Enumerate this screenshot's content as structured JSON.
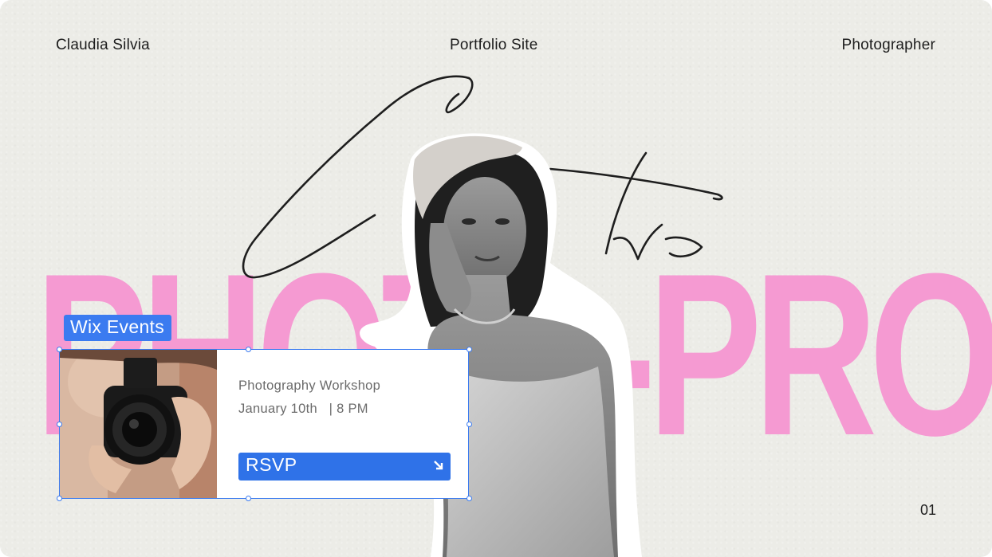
{
  "header": {
    "left": "Claudia Silvia",
    "center": "Portfolio Site",
    "right": "Photographer"
  },
  "hero": {
    "script_word": "Creative",
    "big_text": "PHOTO-PRO"
  },
  "page_number": "01",
  "widget": {
    "tag": "Wix Events",
    "event_title": "Photography Workshop",
    "event_date": "January 10th   | 8 PM",
    "button_label": "RSVP"
  },
  "colors": {
    "background": "#ecece7",
    "pink": "#f59ad2",
    "accent_blue": "#3b7bf0",
    "button_blue": "#2f72e8"
  }
}
